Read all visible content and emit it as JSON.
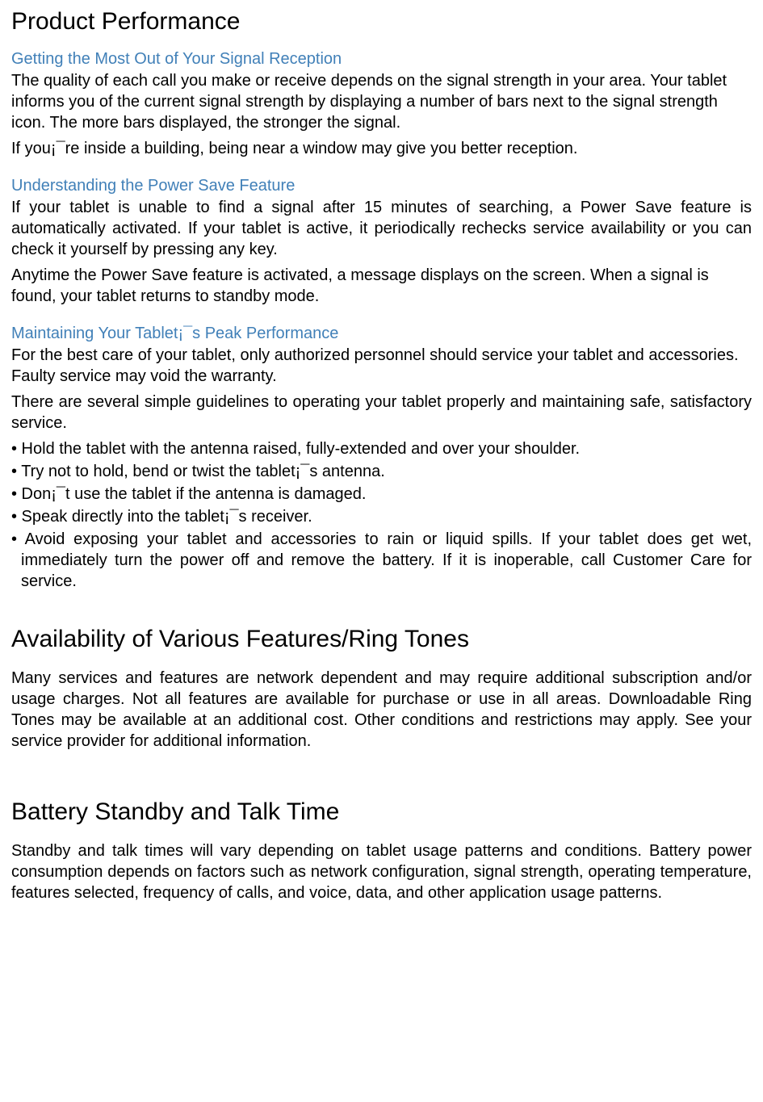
{
  "section1": {
    "title": "Product Performance",
    "sub1": {
      "heading": "Getting the Most Out of Your Signal Reception",
      "para1": "The quality of each call you make or receive depends on the signal strength in your area. Your tablet informs you of the current signal strength by displaying a number of bars next to the signal strength icon. The more bars displayed, the stronger the signal.",
      "para2": "If you¡¯re inside a building, being near a window may give you better reception."
    },
    "sub2": {
      "heading": "Understanding the Power Save Feature",
      "para1": "If your tablet is unable to find a signal after 15 minutes of searching, a Power Save feature is automatically activated. If your tablet is active, it periodically rechecks service availability or you can check it yourself by pressing any key.",
      "para2": "Anytime the Power Save feature is activated, a message displays on the screen. When a signal is found, your tablet returns to standby mode."
    },
    "sub3": {
      "heading": "Maintaining Your Tablet¡¯s Peak Performance",
      "para1": "For the best care of your tablet, only authorized personnel should service your tablet and accessories. Faulty service may void the warranty.",
      "para2": "There are several simple guidelines to operating your tablet properly and maintaining safe, satisfactory service.",
      "bullets": [
        "• Hold the tablet with the antenna raised, fully-extended and over your shoulder.",
        "• Try not to hold, bend or twist the tablet¡¯s antenna.",
        "• Don¡¯t use the tablet if the antenna is damaged.",
        "• Speak directly into the tablet¡¯s receiver.",
        "• Avoid exposing your tablet and accessories to rain or liquid spills. If your tablet does get wet, immediately turn the power off and remove the battery. If it is inoperable, call Customer Care for service."
      ]
    }
  },
  "section2": {
    "title": "Availability of Various Features/Ring Tones",
    "para1": "Many services and features are network dependent and may require additional subscription and/or usage charges. Not all features are available for purchase or use in all areas. Downloadable Ring Tones may be available at an additional cost. Other conditions and restrictions may apply. See your service provider for additional information."
  },
  "section3": {
    "title": "Battery Standby and Talk Time",
    "para1": "Standby and talk times will vary depending on tablet usage patterns and conditions. Battery power consumption depends on factors such as network configuration, signal strength, operating temperature, features selected, frequency of calls, and voice, data, and other application usage patterns."
  }
}
